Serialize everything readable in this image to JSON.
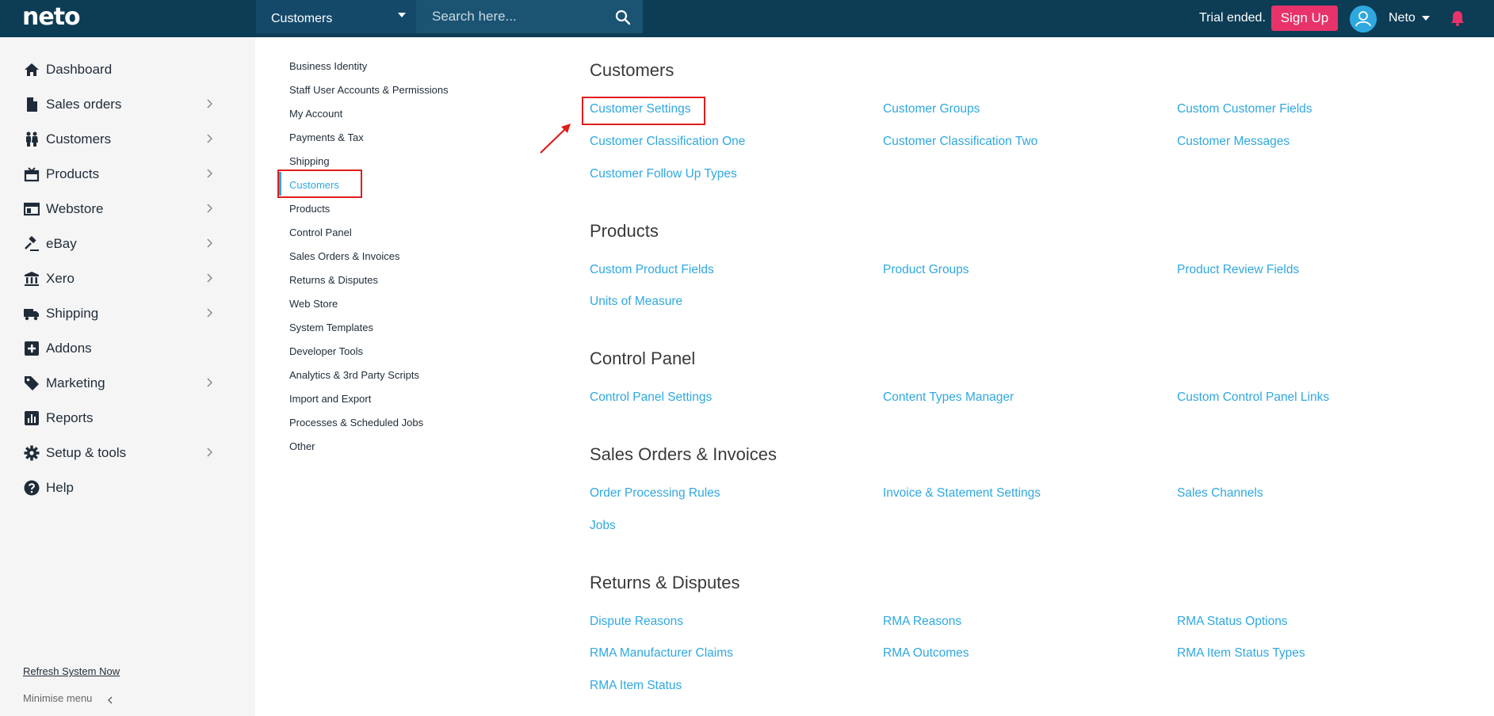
{
  "app": {
    "logo": "neto",
    "search": {
      "category": "Customers",
      "placeholder": "Search here..."
    },
    "trial_text": "Trial ended.",
    "signup_label": "Sign Up",
    "user_name": "Neto"
  },
  "sidebar": {
    "items": [
      {
        "label": "Dashboard",
        "icon": "home-icon",
        "chevron": false
      },
      {
        "label": "Sales orders",
        "icon": "document-icon",
        "chevron": true
      },
      {
        "label": "Customers",
        "icon": "people-icon",
        "chevron": true
      },
      {
        "label": "Products",
        "icon": "box-icon",
        "chevron": true
      },
      {
        "label": "Webstore",
        "icon": "window-icon",
        "chevron": true
      },
      {
        "label": "eBay",
        "icon": "gavel-icon",
        "chevron": true
      },
      {
        "label": "Xero",
        "icon": "bank-icon",
        "chevron": true
      },
      {
        "label": "Shipping",
        "icon": "truck-icon",
        "chevron": true
      },
      {
        "label": "Addons",
        "icon": "plus-square-icon",
        "chevron": false
      },
      {
        "label": "Marketing",
        "icon": "tag-icon",
        "chevron": true
      },
      {
        "label": "Reports",
        "icon": "chart-icon",
        "chevron": false
      },
      {
        "label": "Setup & tools",
        "icon": "gear-icon",
        "chevron": true
      },
      {
        "label": "Help",
        "icon": "question-icon",
        "chevron": false
      }
    ],
    "refresh_label": "Refresh System Now",
    "minimise_label": "Minimise menu"
  },
  "submenu": {
    "items": [
      "Business Identity",
      "Staff User Accounts & Permissions",
      "My Account",
      "Payments & Tax",
      "Shipping",
      "Customers",
      "Products",
      "Control Panel",
      "Sales Orders & Invoices",
      "Returns & Disputes",
      "Web Store",
      "System Templates",
      "Developer Tools",
      "Analytics & 3rd Party Scripts",
      "Import and Export",
      "Processes & Scheduled Jobs",
      "Other"
    ],
    "active": "Customers"
  },
  "sections": [
    {
      "title": "Customers",
      "links": [
        "Customer Settings",
        "Customer Groups",
        "Custom Customer Fields",
        "Customer Classification One",
        "Customer Classification Two",
        "Customer Messages",
        "Customer Follow Up Types"
      ]
    },
    {
      "title": "Products",
      "links": [
        "Custom Product Fields",
        "Product Groups",
        "Product Review Fields",
        "Units of Measure"
      ]
    },
    {
      "title": "Control Panel",
      "links": [
        "Control Panel Settings",
        "Content Types Manager",
        "Custom Control Panel Links"
      ]
    },
    {
      "title": "Sales Orders & Invoices",
      "links": [
        "Order Processing Rules",
        "Invoice & Statement Settings",
        "Sales Channels",
        "Jobs"
      ]
    },
    {
      "title": "Returns & Disputes",
      "links": [
        "Dispute Reasons",
        "RMA Reasons",
        "RMA Status Options",
        "RMA Manufacturer Claims",
        "RMA Outcomes",
        "RMA Item Status Types",
        "RMA Item Status"
      ]
    }
  ],
  "colors": {
    "topbar": "#0d3c55",
    "link": "#2fa8e0",
    "signup": "#e7336a",
    "highlight": "#e01c1c"
  }
}
